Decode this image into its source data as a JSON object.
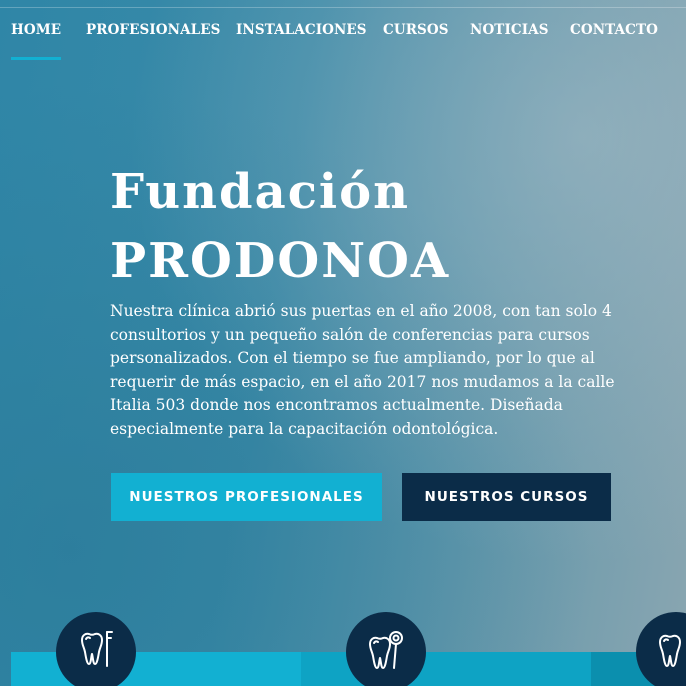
{
  "nav": {
    "items": [
      {
        "label": "HOME",
        "active": true
      },
      {
        "label": "PROFESIONALES",
        "active": false
      },
      {
        "label": "INSTALACIONES",
        "active": false
      },
      {
        "label": "CURSOS",
        "active": false
      },
      {
        "label": "NOTICIAS",
        "active": false
      },
      {
        "label": "CONTACTO",
        "active": false
      }
    ]
  },
  "hero": {
    "title_line1": "Fundación",
    "title_line2": "PRODONOA",
    "description": "Nuestra clínica abrió sus puertas en el año 2008, con tan solo 4 consultorios y un pequeño salón de conferencias para cursos personalizados. Con el tiempo se fue ampliando, por lo que al requerir de más espacio, en el año 2017 nos mudamos a la calle Italia 503 donde nos encontramos actualmente. Diseñada especialmente para la capacitación odontológica.",
    "buttons": {
      "primary": "NUESTROS PROFESIONALES",
      "secondary": "NUESTROS CURSOS"
    }
  },
  "features": {
    "icons": [
      "tooth-instrument-icon",
      "tooth-mirror-icon",
      "tooth-icon"
    ]
  },
  "colors": {
    "accent": "#12b0d2",
    "dark": "#0b2c48",
    "text": "#ffffff"
  }
}
